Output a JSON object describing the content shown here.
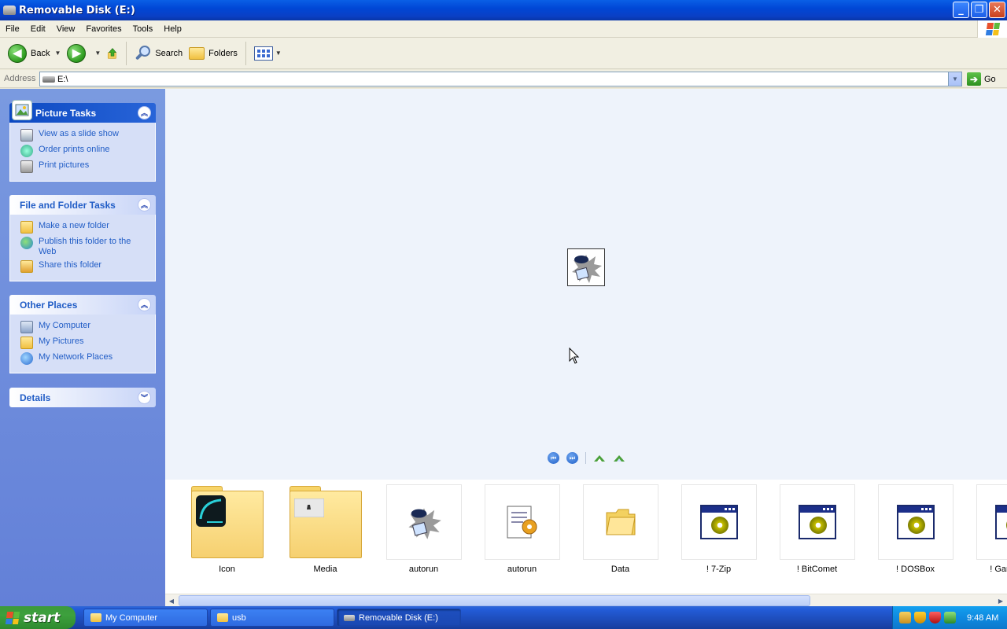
{
  "window": {
    "title": "Removable Disk (E:)",
    "minimize": "_",
    "restore": "❐",
    "close": "✕"
  },
  "menu": [
    "File",
    "Edit",
    "View",
    "Favorites",
    "Tools",
    "Help"
  ],
  "toolbar": {
    "back_label": "Back",
    "search_label": "Search",
    "folders_label": "Folders"
  },
  "address": {
    "label": "Address",
    "value": "E:\\",
    "go_label": "Go"
  },
  "taskpane": {
    "picture_tasks": {
      "title": "Picture Tasks",
      "items": [
        "View as a slide show",
        "Order prints online",
        "Print pictures"
      ]
    },
    "file_folder_tasks": {
      "title": "File and Folder Tasks",
      "items": [
        "Make a new folder",
        "Publish this folder to the Web",
        "Share this folder"
      ]
    },
    "other_places": {
      "title": "Other Places",
      "items": [
        "My Computer",
        "My Pictures",
        "My Network Places"
      ]
    },
    "details": {
      "title": "Details"
    }
  },
  "files": [
    {
      "name": "Icon",
      "kind": "folder-with-image"
    },
    {
      "name": "Media",
      "kind": "folder-with-image"
    },
    {
      "name": "autorun",
      "kind": "icon-image"
    },
    {
      "name": "autorun",
      "kind": "setup-info"
    },
    {
      "name": "Data",
      "kind": "folder"
    },
    {
      "name": "! 7-Zip",
      "kind": "program"
    },
    {
      "name": "! BitComet",
      "kind": "program"
    },
    {
      "name": "! DOSBox",
      "kind": "program"
    },
    {
      "name": "! Game Expl",
      "kind": "program"
    }
  ],
  "taskbar": {
    "start_label": "start",
    "buttons": [
      {
        "label": "My Computer",
        "active": false
      },
      {
        "label": "usb",
        "active": false
      },
      {
        "label": "Removable Disk (E:)",
        "active": true
      }
    ],
    "clock": "9:48 AM"
  },
  "colors": {
    "title_blue": "#0a3fc4",
    "taskpane_blue": "#6f8ddc",
    "link_blue": "#215dc6",
    "preview_bg": "#eef3fb",
    "start_green": "#3da03d"
  }
}
